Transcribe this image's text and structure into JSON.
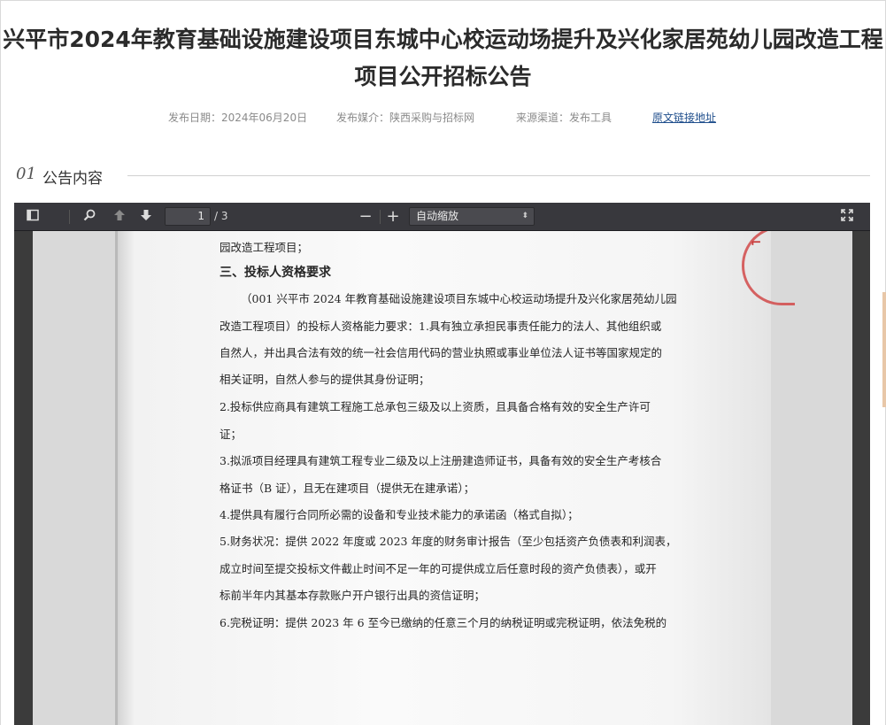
{
  "header": {
    "title_line1": "兴平市2024年教育基础设施建设项目东城中心校运动场提升及兴化家居苑幼儿园改造工程",
    "title_line2": "项目公开招标公告"
  },
  "meta": {
    "publish_date": "发布日期：2024年06月20日",
    "publish_media": "发布媒介：陕西采购与招标网",
    "source_channel": "来源渠道：发布工具",
    "original_link": "原文链接地址"
  },
  "section": {
    "number": "01",
    "title": "公告内容"
  },
  "viewer": {
    "current_page": "1",
    "page_count": "/ 3",
    "zoom": "自动缩放",
    "icons": [
      "sidebar-toggle-icon",
      "search-icon",
      "previous-page-icon",
      "next-page-icon",
      "zoom-out-icon",
      "zoom-in-icon",
      "presentation-mode-icon"
    ]
  },
  "document": {
    "lines": [
      "园改造工程项目；",
      "三、投标人资格要求",
      "（001 兴平市 2024 年教育基础设施建设项目东城中心校运动场提升及兴化家居苑幼儿园",
      "改造工程项目）的投标人资格能力要求：1.具有独立承担民事责任能力的法人、其他组织或",
      "自然人，并出具合法有效的统一社会信用代码的营业执照或事业单位法人证书等国家规定的",
      "相关证明，自然人参与的提供其身份证明；",
      "2.投标供应商具有建筑工程施工总承包三级及以上资质，且具备合格有效的安全生产许可",
      "证；",
      "3.拟派项目经理具有建筑工程专业二级及以上注册建造师证书，具备有效的安全生产考核合",
      "格证书（B 证），且无在建项目（提供无在建承诺）；",
      "4.提供具有履行合同所必需的设备和专业技术能力的承诺函（格式自拟）；",
      "5.财务状况：提供 2022 年度或 2023 年度的财务审计报告（至少包括资产负债表和利润表，",
      "成立时间至提交投标文件截止时间不足一年的可提供成立后任意时段的资产负债表），或开",
      "标前半年内其基本存款账户开户银行出具的资信证明；",
      "6.完税证明：提供 2023 年 6 至今已缴纳的任意三个月的纳税证明或完税证明，依法免税的"
    ]
  },
  "colors": {
    "link": "#1f4e8c",
    "toolbar": "#38383d",
    "stamp": "#d24a4a"
  }
}
